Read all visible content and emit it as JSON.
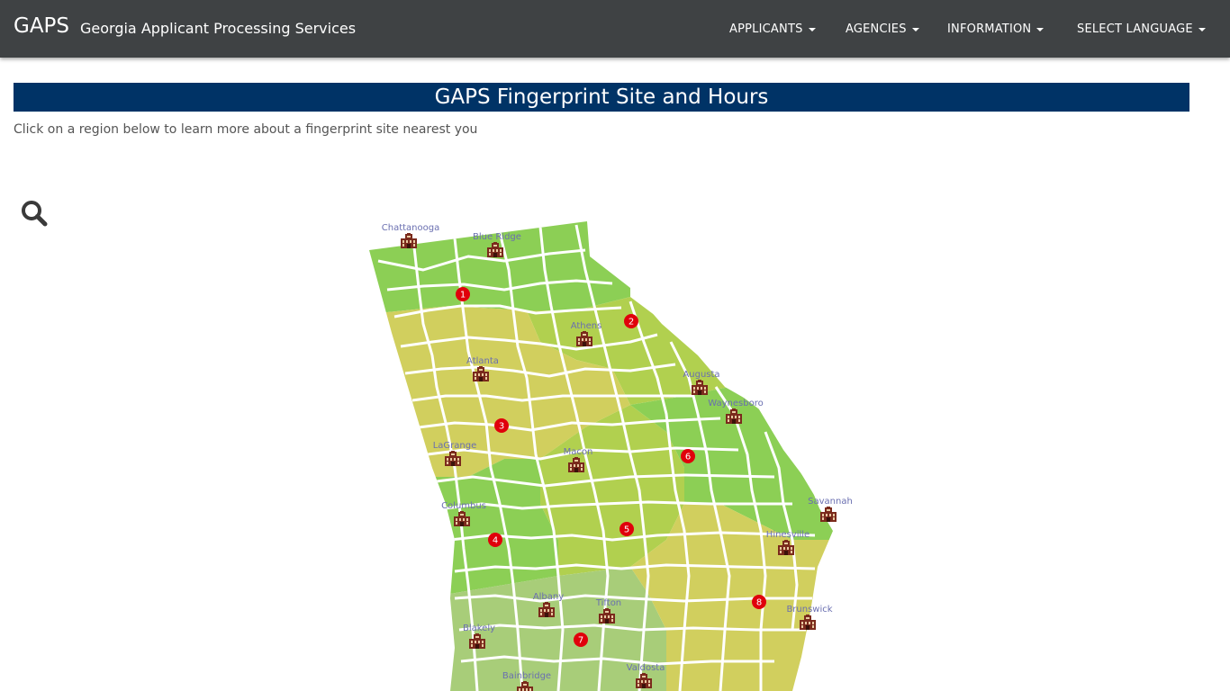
{
  "header": {
    "brand": "GAPS",
    "subtitle": "Georgia Applicant Processing Services",
    "nav": {
      "applicants": "APPLICANTS",
      "agencies": "AGENCIES",
      "information": "INFORMATION",
      "language": "SELECT LANGUAGE"
    }
  },
  "page": {
    "title": "GAPS Fingerprint Site and Hours",
    "intro": "Click on a region below to learn more about a fingerprint site nearest you"
  },
  "map": {
    "cities": [
      "Chattanooga",
      "Blue Ridge",
      "Athens",
      "Atlanta",
      "Augusta",
      "Waynesboro",
      "LaGrange",
      "Macon",
      "Columbus",
      "Savannah",
      "Hinesville",
      "Albany",
      "Tifton",
      "Brunswick",
      "Blakely",
      "Valdosta",
      "Bainbridge"
    ],
    "regions": [
      "1",
      "2",
      "3",
      "4",
      "5",
      "6",
      "7",
      "8"
    ]
  },
  "colors": {
    "navbar": "#3f4244",
    "title_bar": "#003366",
    "marker": "#e0000b",
    "region_green": "#8ccf55",
    "region_yellow": "#d1cf5e",
    "region_lime": "#b1d04f",
    "region_pale": "#a8cd79"
  },
  "icons": {
    "search": "search-icon",
    "site": "building-icon"
  }
}
